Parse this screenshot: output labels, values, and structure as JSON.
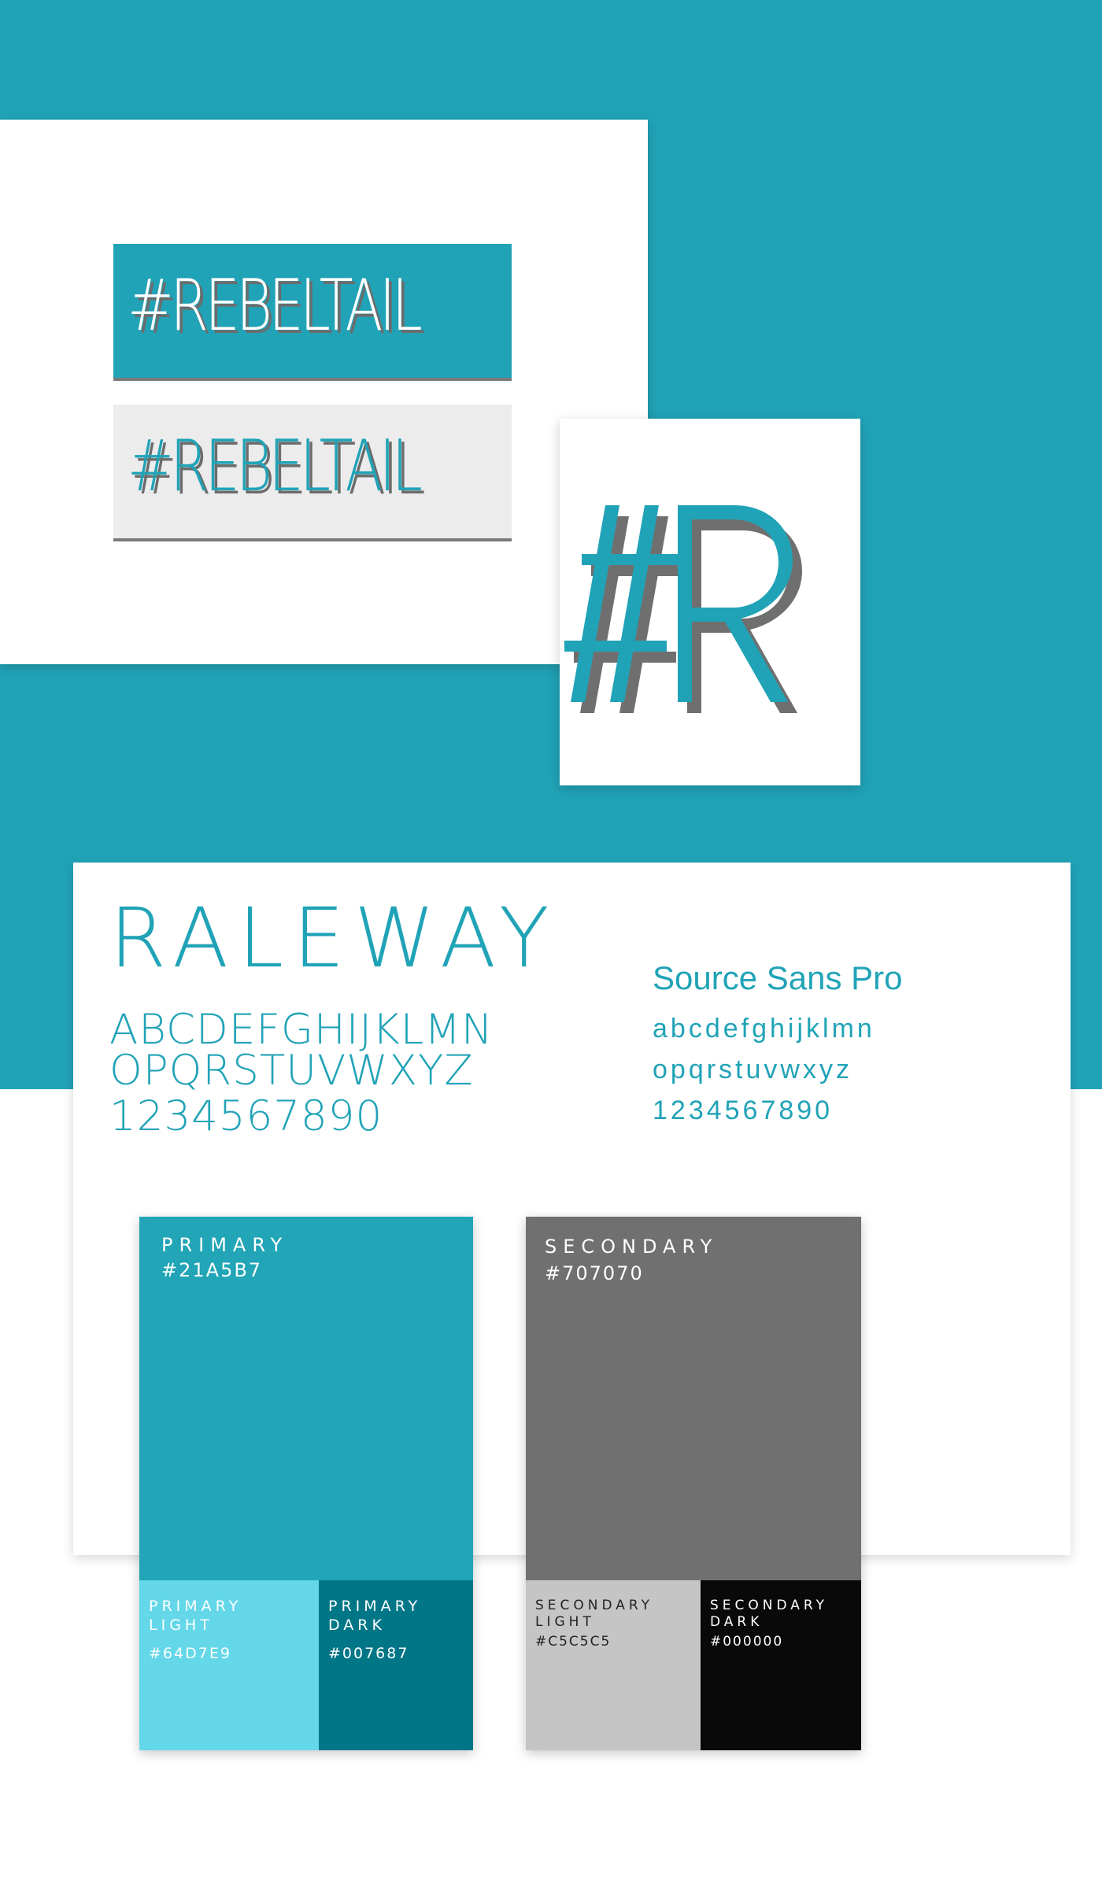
{
  "logo": {
    "wordmark": "#REBELTAIL",
    "monogram": "#R"
  },
  "colors": {
    "primary": "#21A5B7",
    "primary_light": "#64D7E9",
    "primary_dark": "#007687",
    "secondary": "#707070",
    "secondary_light": "#C5C5C5",
    "secondary_dark": "#000000",
    "background_teal": "#21A3B7"
  },
  "typography": {
    "heading_font": {
      "name": "RALEWAY",
      "uppercase": "ABCDEFGHIJKLMN",
      "uppercase2": "OPQRSTUVWXYZ",
      "digits": "1234567890"
    },
    "body_font": {
      "name": "Source Sans Pro",
      "lowercase": "abcdefghijklmn",
      "lowercase2": "opqrstuvwxyz",
      "digits": "1234567890"
    }
  },
  "swatches": {
    "primary": {
      "label": "PRIMARY",
      "hex": "#21A5B7",
      "light": {
        "label": "PRIMARY\nLIGHT",
        "hex": "#64D7E9"
      },
      "dark": {
        "label": "PRIMARY\nDARK",
        "hex": "#007687"
      }
    },
    "secondary": {
      "label": "SECONDARY",
      "hex": "#707070",
      "light": {
        "label": "SECONDARY\nLIGHT",
        "hex": "#C5C5C5"
      },
      "dark": {
        "label": "SECONDARY\nDARK",
        "hex": "#000000"
      }
    }
  }
}
